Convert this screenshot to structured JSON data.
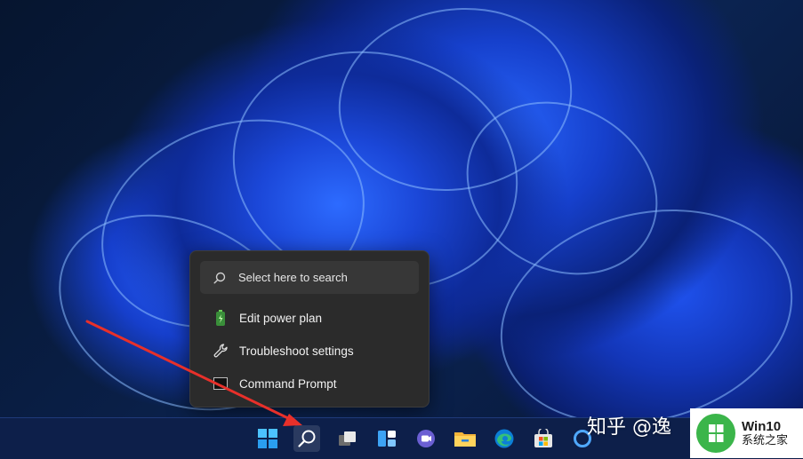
{
  "search_menu": {
    "search_placeholder": "Select here to search",
    "items": [
      {
        "label": "Edit power plan",
        "icon": "battery-icon"
      },
      {
        "label": "Troubleshoot settings",
        "icon": "wrench-icon"
      },
      {
        "label": "Command Prompt",
        "icon": "terminal-icon"
      }
    ]
  },
  "taskbar": {
    "icons": [
      "windows-start-icon",
      "search-icon",
      "task-view-icon",
      "widgets-icon",
      "teams-chat-icon",
      "file-explorer-icon",
      "edge-icon",
      "microsoft-store-icon",
      "cortana-icon"
    ]
  },
  "watermark": {
    "zhihu_text": "知乎 @逸",
    "brand_name": "Win10",
    "brand_subtitle": "系统之家"
  },
  "colors": {
    "menu_bg": "#2b2b2b",
    "taskbar_bg": "#0d1f4a",
    "arrow": "#e8302a",
    "brand_green": "#3bb54a"
  }
}
